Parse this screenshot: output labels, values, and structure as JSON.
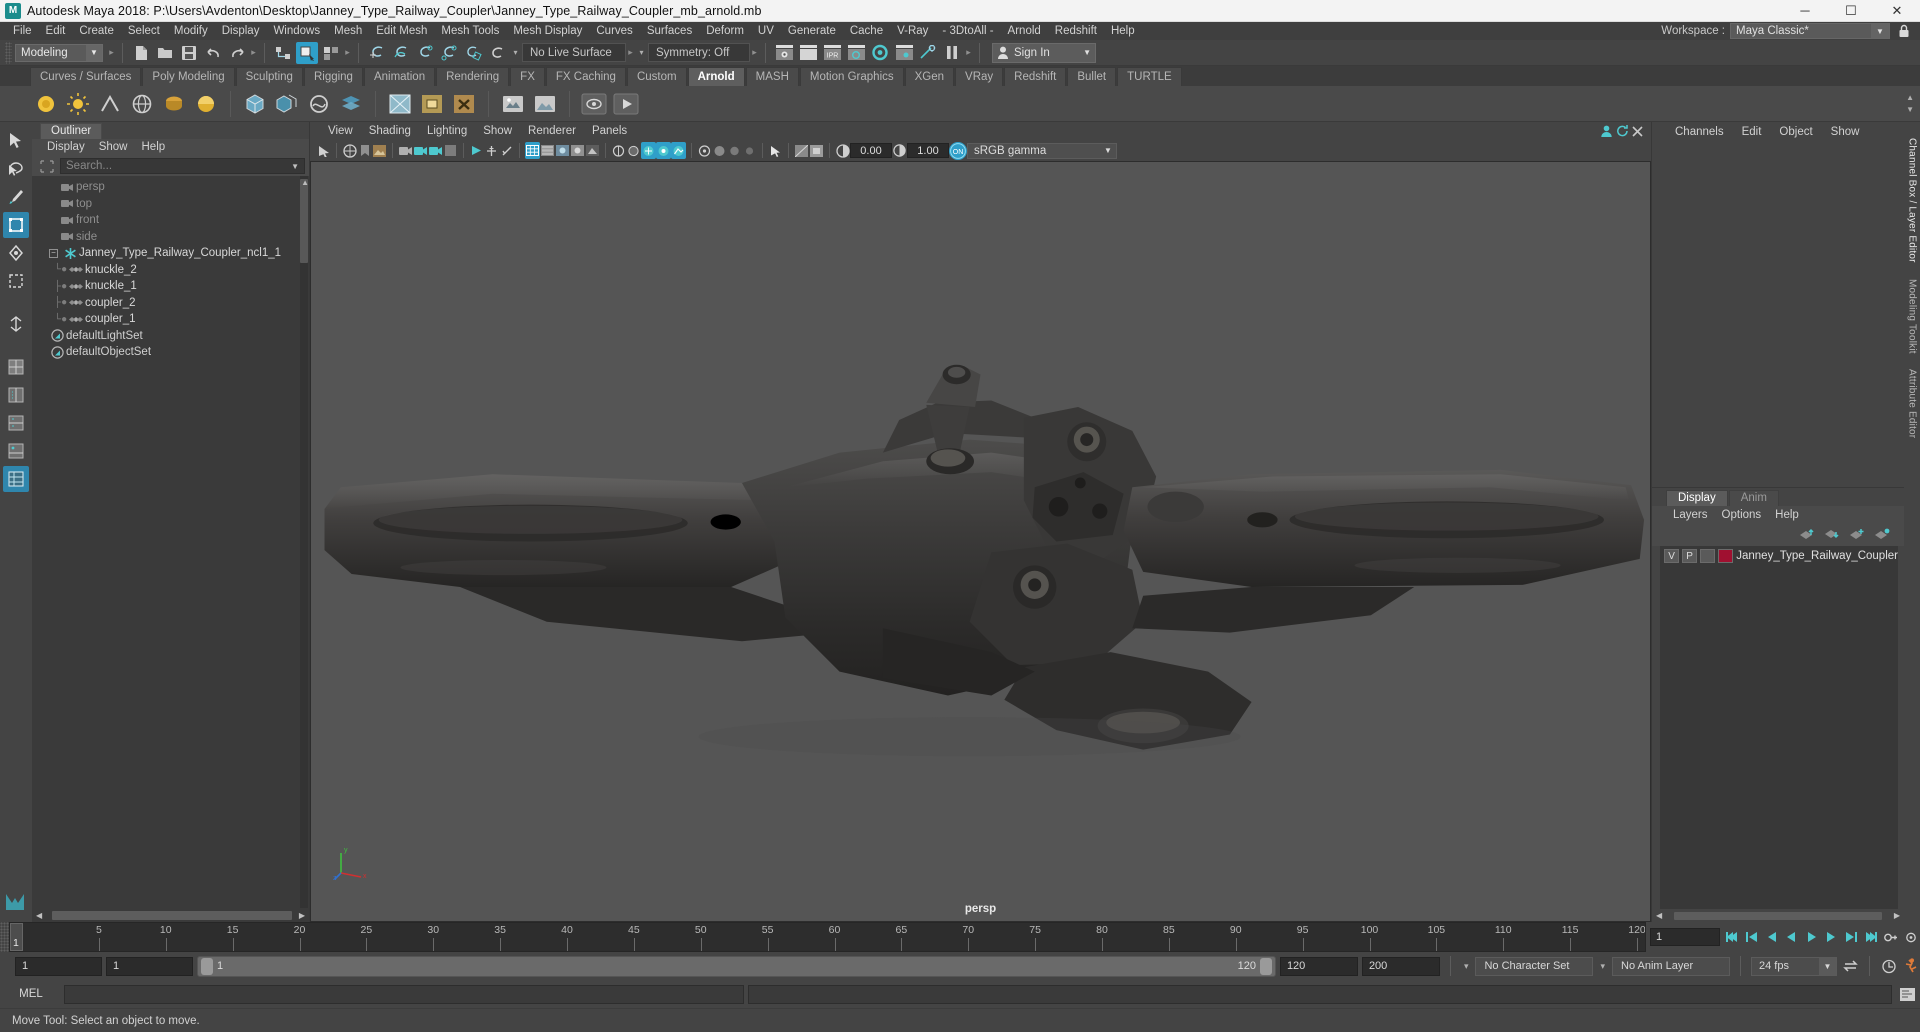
{
  "titlebar": {
    "logo": "M",
    "title": "Autodesk Maya 2018: P:\\Users\\Avdenton\\Desktop\\Janney_Type_Railway_Coupler\\Janney_Type_Railway_Coupler_mb_arnold.mb",
    "minimize": "─",
    "maximize": "☐",
    "close": "✕"
  },
  "menubar": {
    "items": [
      "File",
      "Edit",
      "Create",
      "Select",
      "Modify",
      "Display",
      "Windows",
      "Mesh",
      "Edit Mesh",
      "Mesh Tools",
      "Mesh Display",
      "Curves",
      "Surfaces",
      "Deform",
      "UV",
      "Generate",
      "Cache",
      "V-Ray",
      "- 3DtoAll -",
      "Arnold",
      "Redshift",
      "Help"
    ],
    "workspace_label": "Workspace :",
    "workspace_value": "Maya Classic*",
    "workspace_caret": "▼",
    "lock_icon": "lock-icon"
  },
  "statusline": {
    "mode": "Modeling",
    "mode_caret": "▼",
    "live_surface": "No Live Surface",
    "symmetry": "Symmetry: Off",
    "signin": "Sign In",
    "signin_caret": "▼",
    "caret_small": "▾"
  },
  "shelf": {
    "tabs": [
      {
        "label": "Curves / Surfaces",
        "active": false
      },
      {
        "label": "Poly Modeling",
        "active": false
      },
      {
        "label": "Sculpting",
        "active": false
      },
      {
        "label": "Rigging",
        "active": false
      },
      {
        "label": "Animation",
        "active": false
      },
      {
        "label": "Rendering",
        "active": false
      },
      {
        "label": "FX",
        "active": false
      },
      {
        "label": "FX Caching",
        "active": false
      },
      {
        "label": "Custom",
        "active": false
      },
      {
        "label": "Arnold",
        "active": true
      },
      {
        "label": "MASH",
        "active": false
      },
      {
        "label": "Motion Graphics",
        "active": false
      },
      {
        "label": "XGen",
        "active": false
      },
      {
        "label": "VRay",
        "active": false
      },
      {
        "label": "Redshift",
        "active": false
      },
      {
        "label": "Bullet",
        "active": false
      },
      {
        "label": "TURTLE",
        "active": false
      }
    ]
  },
  "outliner": {
    "tab": "Outliner",
    "menus": [
      "Display",
      "Show",
      "Help"
    ],
    "search_placeholder": "Search...",
    "search_value": "",
    "search_caret": "▼",
    "tree": [
      {
        "label": "persp",
        "icon": "camera-icon",
        "type": "camera",
        "depth": 1
      },
      {
        "label": "top",
        "icon": "camera-icon",
        "type": "camera",
        "depth": 1
      },
      {
        "label": "front",
        "icon": "camera-icon",
        "type": "camera",
        "depth": 1
      },
      {
        "label": "side",
        "icon": "camera-icon",
        "type": "camera",
        "depth": 1
      },
      {
        "label": "Janney_Type_Railway_Coupler_ncl1_1",
        "icon": "asterisk-icon",
        "type": "group",
        "depth": 0,
        "expanded": true
      },
      {
        "label": "knuckle_2",
        "icon": "mesh-icon",
        "type": "child",
        "depth": 1
      },
      {
        "label": "knuckle_1",
        "icon": "mesh-icon",
        "type": "child",
        "depth": 1
      },
      {
        "label": "coupler_2",
        "icon": "mesh-icon",
        "type": "child",
        "depth": 1
      },
      {
        "label": "coupler_1",
        "icon": "mesh-icon",
        "type": "child",
        "depth": 1
      },
      {
        "label": "defaultLightSet",
        "icon": "set-icon",
        "type": "set",
        "depth": 1
      },
      {
        "label": "defaultObjectSet",
        "icon": "set-icon",
        "type": "set",
        "depth": 1
      }
    ]
  },
  "viewport": {
    "menus": [
      "View",
      "Shading",
      "Lighting",
      "Show",
      "Renderer",
      "Panels"
    ],
    "exposure_value": "0.00",
    "gamma_value": "1.00",
    "colorspace": "sRGB gamma",
    "colorspace_caret": "▼",
    "camera_label": "persp",
    "gizmo_axes": [
      "x",
      "y",
      "z"
    ]
  },
  "rightpanel": {
    "menus": [
      "Channels",
      "Edit",
      "Object",
      "Show"
    ],
    "vtabs": [
      "Channel Box / Layer Editor",
      "Modeling Toolkit",
      "Attribute Editor"
    ],
    "layers": {
      "tabs": [
        {
          "label": "Display",
          "active": true
        },
        {
          "label": "Anim",
          "active": false
        }
      ],
      "menus": [
        "Layers",
        "Options",
        "Help"
      ],
      "rows": [
        {
          "v": "V",
          "p": "P",
          "shade": "",
          "color": "#a01030",
          "name": "Janney_Type_Railway_Coupler"
        }
      ]
    }
  },
  "timeline": {
    "labels": [
      "5",
      "10",
      "15",
      "20",
      "25",
      "30",
      "35",
      "40",
      "45",
      "50",
      "55",
      "60",
      "65",
      "70",
      "75",
      "80",
      "85",
      "90",
      "95",
      "100",
      "105",
      "110",
      "115",
      "120"
    ],
    "current_frame": "1",
    "end_field": "1"
  },
  "playback": {
    "start_field": "1",
    "anim_start_field": "1",
    "range_start": "1",
    "range_end": "120",
    "playback_end": "120",
    "anim_end": "200",
    "character_set": "No Character Set",
    "anim_layer": "No Anim Layer",
    "fps": "24 fps",
    "fps_caret": "▼"
  },
  "mel": {
    "label": "MEL",
    "value": ""
  },
  "helpline": {
    "text": "Move Tool: Select an object to move."
  },
  "colors": {
    "accent_blue": "#2f9fc9",
    "tool_active": "#2f86ad",
    "teal": "#4ec9cf",
    "orange": "#e07b39",
    "layer_red": "#a01030",
    "viewport_bg": "#555555"
  }
}
